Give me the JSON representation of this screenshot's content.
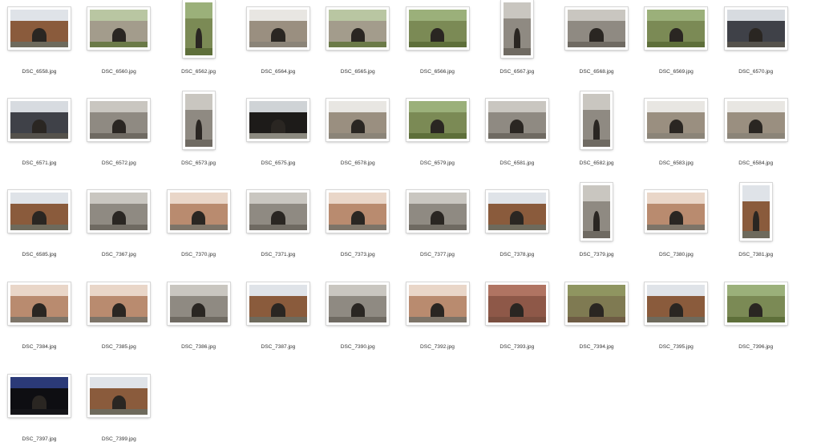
{
  "files": [
    {
      "name": "DSC_6558.jpg",
      "orient": "land",
      "palette": "tower"
    },
    {
      "name": "DSC_6560.jpg",
      "orient": "land",
      "palette": "wall"
    },
    {
      "name": "DSC_6562.jpg",
      "orient": "port",
      "palette": "green"
    },
    {
      "name": "DSC_6564.jpg",
      "orient": "land",
      "palette": "court"
    },
    {
      "name": "DSC_6565.jpg",
      "orient": "land",
      "palette": "wall"
    },
    {
      "name": "DSC_6566.jpg",
      "orient": "land",
      "palette": "green"
    },
    {
      "name": "DSC_6567.jpg",
      "orient": "port",
      "palette": "stone"
    },
    {
      "name": "DSC_6568.jpg",
      "orient": "land",
      "palette": "stone"
    },
    {
      "name": "DSC_6569.jpg",
      "orient": "land",
      "palette": "green"
    },
    {
      "name": "DSC_6570.jpg",
      "orient": "land",
      "palette": "street"
    },
    {
      "name": "DSC_6571.jpg",
      "orient": "land",
      "palette": "street"
    },
    {
      "name": "DSC_6572.jpg",
      "orient": "land",
      "palette": "stone"
    },
    {
      "name": "DSC_6573.jpg",
      "orient": "port",
      "palette": "stone"
    },
    {
      "name": "DSC_6575.jpg",
      "orient": "land",
      "palette": "dark"
    },
    {
      "name": "DSC_6578.jpg",
      "orient": "land",
      "palette": "court"
    },
    {
      "name": "DSC_6579.jpg",
      "orient": "land",
      "palette": "green"
    },
    {
      "name": "DSC_6581.jpg",
      "orient": "land",
      "palette": "stone"
    },
    {
      "name": "DSC_6582.jpg",
      "orient": "port",
      "palette": "stone"
    },
    {
      "name": "DSC_6583.jpg",
      "orient": "land",
      "palette": "court"
    },
    {
      "name": "DSC_6584.jpg",
      "orient": "land",
      "palette": "court"
    },
    {
      "name": "DSC_6585.jpg",
      "orient": "land",
      "palette": "tower"
    },
    {
      "name": "DSC_7367.jpg",
      "orient": "land",
      "palette": "stone"
    },
    {
      "name": "DSC_7370.jpg",
      "orient": "land",
      "palette": "pink"
    },
    {
      "name": "DSC_7371.jpg",
      "orient": "land",
      "palette": "stone"
    },
    {
      "name": "DSC_7373.jpg",
      "orient": "land",
      "palette": "pink"
    },
    {
      "name": "DSC_7377.jpg",
      "orient": "land",
      "palette": "stone"
    },
    {
      "name": "DSC_7378.jpg",
      "orient": "land",
      "palette": "tower"
    },
    {
      "name": "DSC_7379.jpg",
      "orient": "port",
      "palette": "stone"
    },
    {
      "name": "DSC_7380.jpg",
      "orient": "land",
      "palette": "pink"
    },
    {
      "name": "DSC_7381.jpg",
      "orient": "port",
      "palette": "tower"
    },
    {
      "name": "DSC_7384.jpg",
      "orient": "land",
      "palette": "pink"
    },
    {
      "name": "DSC_7385.jpg",
      "orient": "land",
      "palette": "pink"
    },
    {
      "name": "DSC_7386.jpg",
      "orient": "land",
      "palette": "stone"
    },
    {
      "name": "DSC_7387.jpg",
      "orient": "land",
      "palette": "tower"
    },
    {
      "name": "DSC_7390.jpg",
      "orient": "land",
      "palette": "stone"
    },
    {
      "name": "DSC_7392.jpg",
      "orient": "land",
      "palette": "pink"
    },
    {
      "name": "DSC_7393.jpg",
      "orient": "land",
      "palette": "roof"
    },
    {
      "name": "DSC_7394.jpg",
      "orient": "land",
      "palette": "roofgreen"
    },
    {
      "name": "DSC_7395.jpg",
      "orient": "land",
      "palette": "tower"
    },
    {
      "name": "DSC_7396.jpg",
      "orient": "land",
      "palette": "green"
    },
    {
      "name": "DSC_7397.jpg",
      "orient": "land",
      "palette": "night"
    },
    {
      "name": "DSC_7399.jpg",
      "orient": "land",
      "palette": "tower"
    }
  ],
  "palettes": {
    "tower": {
      "sky": "#dfe3e8",
      "mass": "#8a5b3c",
      "ground": "#6e6a5c"
    },
    "wall": {
      "sky": "#b9c6a2",
      "mass": "#a39c8c",
      "ground": "#6b7a48"
    },
    "green": {
      "sky": "#9bb07a",
      "mass": "#7b8a55",
      "ground": "#5e6f3a"
    },
    "court": {
      "sky": "#e8e6e2",
      "mass": "#9a8f80",
      "ground": "#8b8478"
    },
    "stone": {
      "sky": "#c9c6c0",
      "mass": "#8f8a82",
      "ground": "#6f6a62"
    },
    "street": {
      "sky": "#d7dbe0",
      "mass": "#3f4148",
      "ground": "#55524c"
    },
    "dark": {
      "sky": "#cfd3d6",
      "mass": "#1d1b19",
      "ground": "#8c8a80"
    },
    "pink": {
      "sky": "#e9d6c8",
      "mass": "#b98b6f",
      "ground": "#7d7468"
    },
    "roof": {
      "sky": "#b07462",
      "mass": "#8e5848",
      "ground": "#7a4e3f"
    },
    "roofgreen": {
      "sky": "#8f9560",
      "mass": "#7f7a52",
      "ground": "#6e5c44"
    },
    "night": {
      "sky": "#2b3a78",
      "mass": "#0e0e12",
      "ground": "#141418"
    }
  }
}
